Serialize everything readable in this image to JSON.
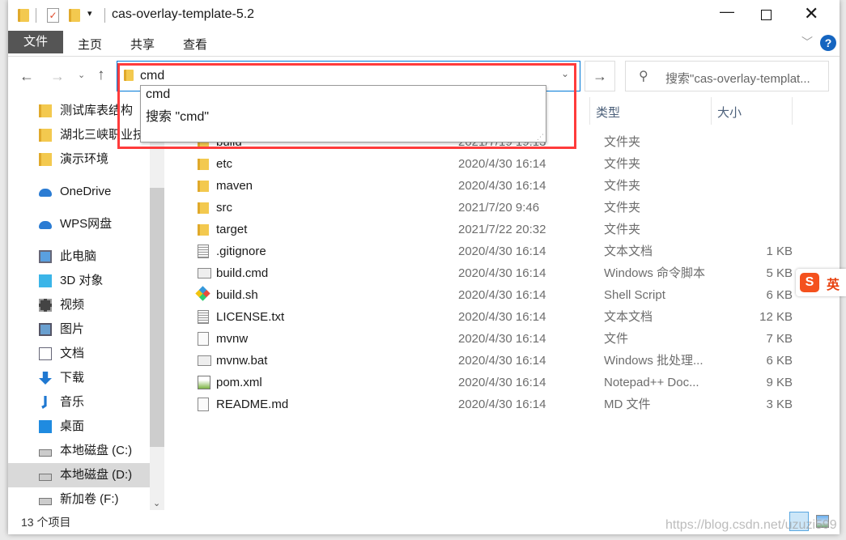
{
  "window": {
    "title": "cas-overlay-template-5.2"
  },
  "ribbon": {
    "tabs": [
      "文件",
      "主页",
      "共享",
      "查看"
    ]
  },
  "address": {
    "value": "cmd",
    "suggestions": [
      "cmd",
      "搜索 \"cmd\""
    ]
  },
  "search": {
    "placeholder": "搜索\"cas-overlay-templat..."
  },
  "columns": {
    "type": "类型",
    "size": "大小"
  },
  "sidebar": {
    "items": [
      {
        "label": "测试库表结构",
        "icon": "folder-icon"
      },
      {
        "label": "湖北三峡职业技",
        "icon": "folder-icon"
      },
      {
        "label": "演示环境",
        "icon": "folder-icon"
      },
      {
        "label": "OneDrive",
        "icon": "cloud-icon"
      },
      {
        "label": "WPS网盘",
        "icon": "cloud-icon"
      },
      {
        "label": "此电脑",
        "icon": "computer-icon"
      },
      {
        "label": "3D 对象",
        "icon": "cube-icon"
      },
      {
        "label": "视频",
        "icon": "video-icon"
      },
      {
        "label": "图片",
        "icon": "picture-icon"
      },
      {
        "label": "文档",
        "icon": "document-icon"
      },
      {
        "label": "下载",
        "icon": "download-icon"
      },
      {
        "label": "音乐",
        "icon": "music-icon"
      },
      {
        "label": "桌面",
        "icon": "desktop-icon"
      },
      {
        "label": "本地磁盘 (C:)",
        "icon": "drive-icon"
      },
      {
        "label": "本地磁盘 (D:)",
        "icon": "drive-icon",
        "selected": true
      },
      {
        "label": "新加卷 (F:)",
        "icon": "drive-icon"
      }
    ]
  },
  "files": [
    {
      "name": "build",
      "date": "2021/7/19 19:13",
      "type": "文件夹",
      "size": "",
      "icon": "folder-icon"
    },
    {
      "name": "etc",
      "date": "2020/4/30 16:14",
      "type": "文件夹",
      "size": "",
      "icon": "folder-icon"
    },
    {
      "name": "maven",
      "date": "2020/4/30 16:14",
      "type": "文件夹",
      "size": "",
      "icon": "folder-icon"
    },
    {
      "name": "src",
      "date": "2021/7/20 9:46",
      "type": "文件夹",
      "size": "",
      "icon": "folder-icon"
    },
    {
      "name": "target",
      "date": "2021/7/22 20:32",
      "type": "文件夹",
      "size": "",
      "icon": "folder-icon"
    },
    {
      "name": ".gitignore",
      "date": "2020/4/30 16:14",
      "type": "文本文档",
      "size": "1 KB",
      "icon": "text-file-icon"
    },
    {
      "name": "build.cmd",
      "date": "2020/4/30 16:14",
      "type": "Windows 命令脚本",
      "size": "5 KB",
      "icon": "script-icon"
    },
    {
      "name": "build.sh",
      "date": "2020/4/30 16:14",
      "type": "Shell Script",
      "size": "6 KB",
      "icon": "git-icon"
    },
    {
      "name": "LICENSE.txt",
      "date": "2020/4/30 16:14",
      "type": "文本文档",
      "size": "12 KB",
      "icon": "text-file-icon"
    },
    {
      "name": "mvnw",
      "date": "2020/4/30 16:14",
      "type": "文件",
      "size": "7 KB",
      "icon": "file-icon"
    },
    {
      "name": "mvnw.bat",
      "date": "2020/4/30 16:14",
      "type": "Windows 批处理...",
      "size": "6 KB",
      "icon": "script-icon"
    },
    {
      "name": "pom.xml",
      "date": "2020/4/30 16:14",
      "type": "Notepad++ Doc...",
      "size": "9 KB",
      "icon": "notepadpp-icon"
    },
    {
      "name": "README.md",
      "date": "2020/4/30 16:14",
      "type": "MD 文件",
      "size": "3 KB",
      "icon": "file-icon"
    }
  ],
  "status": {
    "count": "13 个项目"
  },
  "watermark": "https://blog.csdn.net/uzuzi599",
  "ime": {
    "label": "英"
  },
  "colors": {
    "highlight": "#ff3b3b",
    "accent": "#0067c0",
    "file_tab": "#555555"
  }
}
